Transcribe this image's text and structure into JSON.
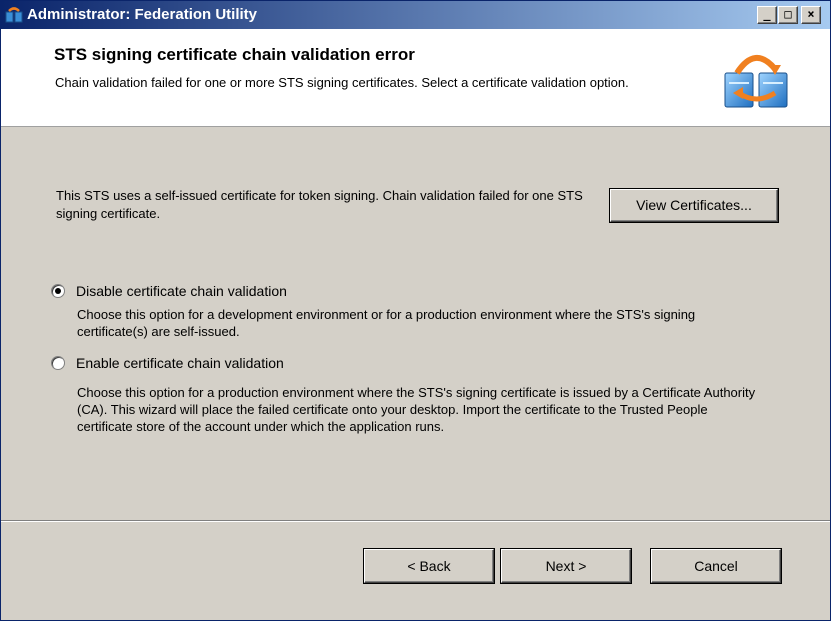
{
  "window": {
    "title": "Administrator: Federation Utility"
  },
  "caption_buttons": {
    "minimize": "_",
    "maximize": "□",
    "close": "×"
  },
  "header": {
    "title": "STS signing certificate chain validation error",
    "subtitle": "Chain validation failed for one or more STS signing certificates. Select a certificate validation option."
  },
  "info": {
    "text": "This STS uses a self-issued certificate for token signing. Chain validation failed for one STS signing certificate.",
    "view_button": "View Certificates..."
  },
  "options": [
    {
      "label": "Disable certificate chain validation",
      "description": "Choose this option for a development environment or for a production environment where the STS's signing certificate(s) are self-issued.",
      "selected": true
    },
    {
      "label": "Enable certificate chain validation",
      "description": "Choose this option for a production environment where the STS's signing certificate is issued by a Certificate Authority (CA).  This wizard will place the failed certificate onto your desktop. Import the certificate to the Trusted People certificate store of the account under which the application runs.",
      "selected": false
    }
  ],
  "footer": {
    "back": "< Back",
    "next": "Next >",
    "cancel": "Cancel"
  },
  "colors": {
    "titlebar_start": "#0a246a",
    "titlebar_end": "#a6caf0",
    "dialog_bg": "#d4d0c8"
  }
}
